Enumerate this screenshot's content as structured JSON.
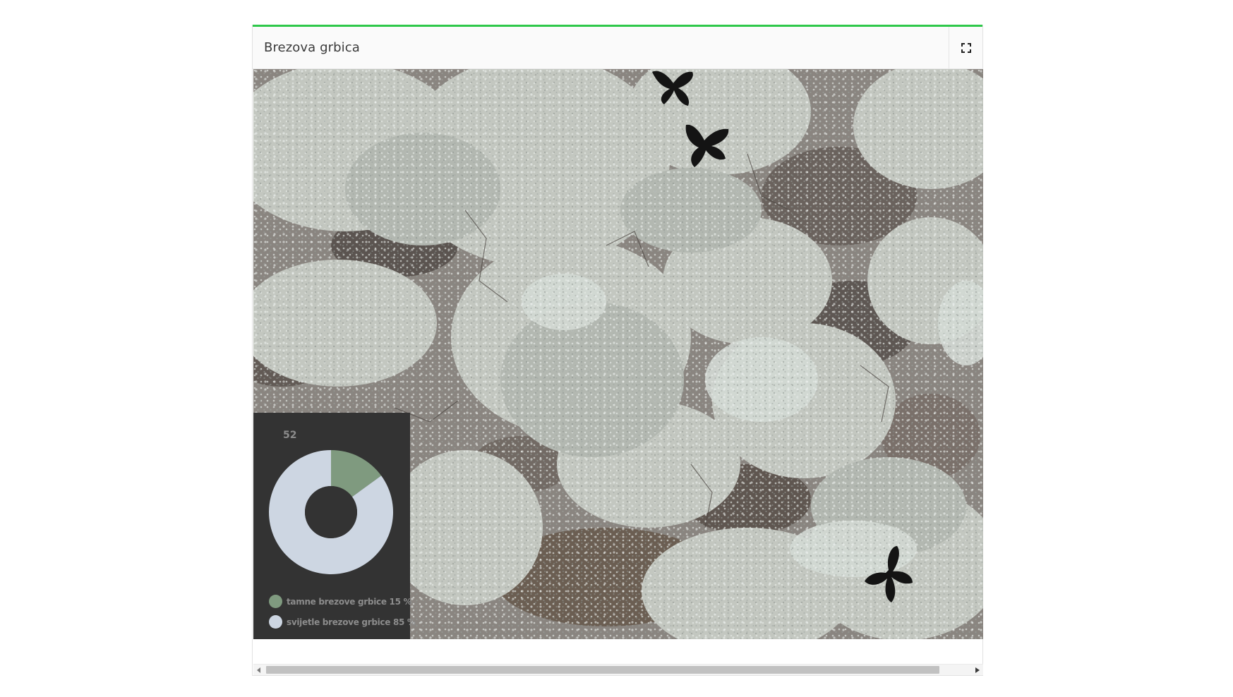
{
  "panel": {
    "title": "Brezova grbica",
    "fullscreen_icon": "fullscreen-icon",
    "accent_color": "#2ec84a"
  },
  "scene": {
    "image": "lichen-covered tree bark with three dark moths",
    "moth_icon": "moth-icon"
  },
  "stats": {
    "count": "52",
    "chart_data": {
      "type": "pie",
      "categories": [
        "tamne brezove grbice",
        "svijetle brezove grbice"
      ],
      "values": [
        15,
        85
      ],
      "colors": [
        "#7f9a7f",
        "#cdd6e2"
      ]
    },
    "legend": [
      {
        "label": "tamne brezove grbice 15 %",
        "color": "#7f9a7f"
      },
      {
        "label": "svijetle brezove grbice 85 %",
        "color": "#cdd6e2"
      }
    ]
  },
  "scrollbar": {
    "left_icon": "scroll-left-icon",
    "right_icon": "scroll-right-icon"
  }
}
